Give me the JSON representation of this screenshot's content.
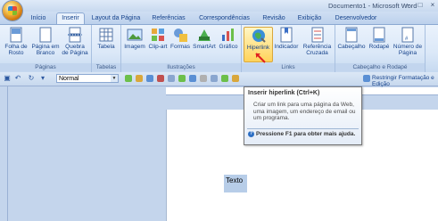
{
  "window": {
    "title": "Documento1 - Microsoft Word"
  },
  "tabs": [
    "Início",
    "Inserir",
    "Layout da Página",
    "Referências",
    "Correspondências",
    "Revisão",
    "Exibição",
    "Desenvolvedor"
  ],
  "active_tab": "Inserir",
  "ribbon": {
    "groups": {
      "paginas": {
        "label": "Páginas",
        "buttons": [
          "Folha de Rosto",
          "Página em Branco",
          "Quebra de Página"
        ]
      },
      "tabelas": {
        "label": "Tabelas",
        "buttons": [
          "Tabela"
        ]
      },
      "ilustracoes": {
        "label": "Ilustrações",
        "buttons": [
          "Imagem",
          "Clip-art",
          "Formas",
          "SmartArt",
          "Gráfico"
        ]
      },
      "links": {
        "label": "Links",
        "buttons": [
          "Hiperlink",
          "Indicador",
          "Referência Cruzada"
        ]
      },
      "cabecalho": {
        "label": "Cabeçalho e Rodapé",
        "buttons": [
          "Cabeçalho",
          "Rodapé",
          "Número de Página"
        ]
      }
    }
  },
  "toolbar": {
    "style_value": "Normal",
    "restrict_label": "Restringir Formatação e Edição"
  },
  "tooltip": {
    "title": "Inserir hiperlink (Ctrl+K)",
    "description": "Criar um link para uma página da Web, uma imagem, um endereço de email ou um programa.",
    "help": "Pressione F1 para obter mais ajuda."
  },
  "document": {
    "selected_text": "Texto"
  },
  "colors": {
    "accent": "#15428b",
    "ribbon": "#dbe8f8",
    "highlight": "#ffd35a"
  }
}
